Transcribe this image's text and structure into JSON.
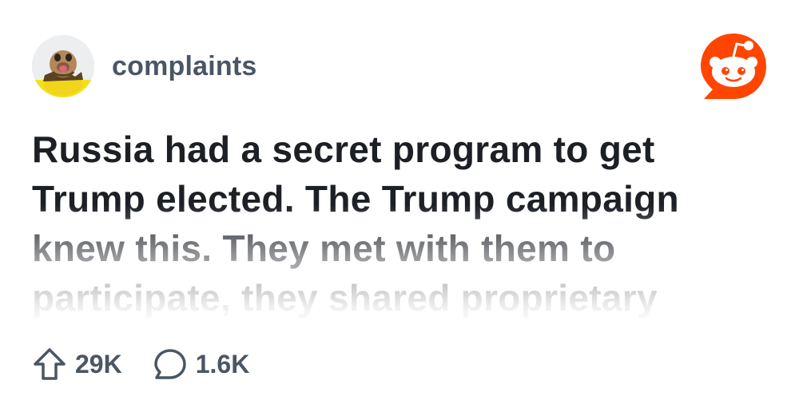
{
  "post": {
    "subreddit": "complaints",
    "title": "Russia had a secret program to get Trump elected. The Trump campaign knew this. They met with them to participate, they shared proprietary",
    "upvotes": "29K",
    "comments": "1.6K"
  },
  "icons": {
    "avatar": "subreddit-avatar-icon",
    "logo": "reddit-logo-icon",
    "upvote": "upvote-arrow-icon",
    "comment": "comment-bubble-icon"
  },
  "colors": {
    "brand": "#ff4500",
    "text": "#1c2026",
    "muted": "#4a5663"
  }
}
